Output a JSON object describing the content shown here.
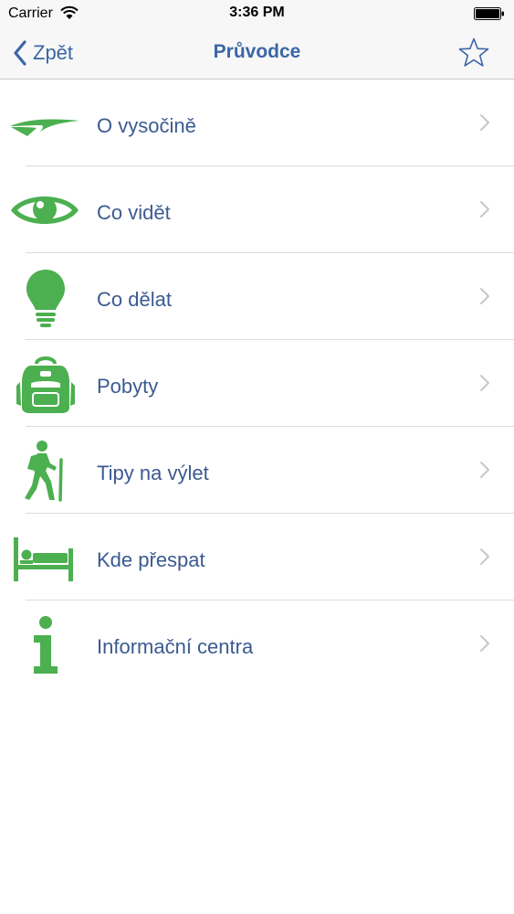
{
  "status_bar": {
    "carrier": "Carrier",
    "time": "3:36 PM"
  },
  "nav": {
    "back_label": "Zpět",
    "title": "Průvodce"
  },
  "colors": {
    "accent": "#3b66a6",
    "icon_green": "#4caf50",
    "label": "#3b5a91"
  },
  "menu": [
    {
      "label": "O vysočině",
      "icon": "vysocina-logo-icon"
    },
    {
      "label": "Co vidět",
      "icon": "eye-icon"
    },
    {
      "label": "Co dělat",
      "icon": "lightbulb-icon"
    },
    {
      "label": "Pobyty",
      "icon": "backpack-icon"
    },
    {
      "label": "Tipy na výlet",
      "icon": "hiker-icon"
    },
    {
      "label": "Kde přespat",
      "icon": "bed-icon"
    },
    {
      "label": "Informační centra",
      "icon": "info-icon"
    }
  ]
}
